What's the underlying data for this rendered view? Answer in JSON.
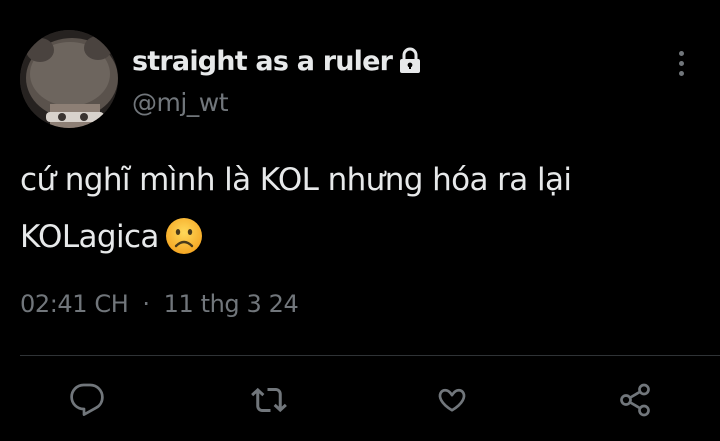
{
  "tweet": {
    "author": {
      "display_name": "straight as a ruler",
      "handle": "@mj_wt",
      "locked": true
    },
    "text_lines": [
      "cứ nghĩ mình là KOL nhưng hóa ra lại",
      "KOLagica"
    ],
    "emoji": "frowning-face",
    "time": "02:41 CH",
    "separator": "·",
    "date": "11 thg 3 24"
  },
  "actions": [
    {
      "icon": "reply-icon"
    },
    {
      "icon": "retweet-icon"
    },
    {
      "icon": "like-icon"
    },
    {
      "icon": "share-icon"
    }
  ],
  "colors": {
    "background": "#000000",
    "primary_text": "#e7e9ea",
    "secondary_text": "#71767b",
    "divider": "#2f3336"
  }
}
